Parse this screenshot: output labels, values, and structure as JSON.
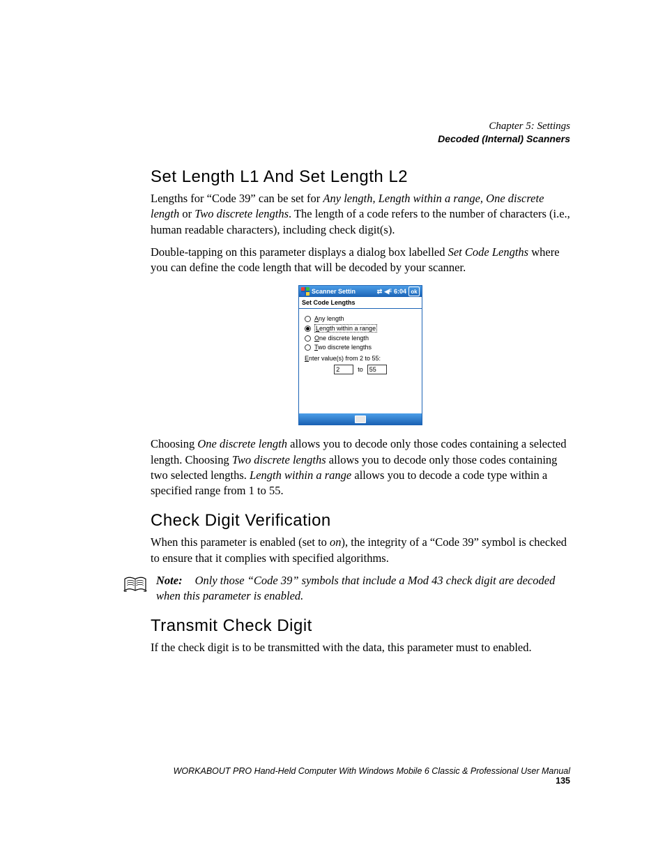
{
  "header": {
    "chapter": "Chapter 5: Settings",
    "section": "Decoded (Internal) Scanners"
  },
  "sections": {
    "set_length": {
      "title": "Set Length L1 And Set Length L2",
      "p1_a": "Lengths for “Code 39” can be set for ",
      "p1_i1": "Any length, Length within a range, One discrete length",
      "p1_b": " or ",
      "p1_i2": "Two discrete lengths",
      "p1_c": ". The length of a code refers to the number of characters (i.e., human readable characters), including check digit(s).",
      "p2_a": "Double-tapping on this parameter displays a dialog box labelled ",
      "p2_i": "Set Code Lengths",
      "p2_b": " where you can define the code length that will be decoded by your scanner.",
      "p3_a": "Choosing ",
      "p3_i1": "One discrete length",
      "p3_b": " allows you to decode only those codes containing a selected length. Choosing ",
      "p3_i2": "Two discrete lengths",
      "p3_c": " allows you to decode only those codes containing two selected lengths. ",
      "p3_i3": "Length within a range",
      "p3_d": " allows you to decode a code type within a specified range from 1 to 55."
    },
    "check_digit": {
      "title": "Check Digit Verification",
      "p_a": "When this parameter is enabled (set to ",
      "p_i": "on",
      "p_b": "), the integrity of a “Code 39” symbol is checked to ensure that it complies with specified algorithms."
    },
    "note": {
      "label": "Note:",
      "text": "Only those “Code 39” symbols that include a Mod 43 check digit are decoded when this parameter is enabled."
    },
    "transmit": {
      "title": "Transmit Check Digit",
      "p": "If the check digit is to be transmitted with the data, this parameter must to enabled."
    }
  },
  "dialog": {
    "titlebar": "Scanner Settin",
    "time": "6:04",
    "ok": "ok",
    "subtitle": "Set Code Lengths",
    "radios": [
      {
        "u": "A",
        "rest": "ny length",
        "selected": false
      },
      {
        "u": "L",
        "rest": "ength within a range",
        "selected": true
      },
      {
        "u": "O",
        "rest": "ne discrete length",
        "selected": false
      },
      {
        "u": "T",
        "rest": "wo discrete lengths",
        "selected": false
      }
    ],
    "enter_u": "E",
    "enter_rest": "nter value(s) from 2 to 55:",
    "val1": "2",
    "to": "to",
    "val2": "55"
  },
  "footer": {
    "text": "WORKABOUT PRO Hand-Held Computer With Windows Mobile 6 Classic & Professional User Manual",
    "page": "135"
  }
}
